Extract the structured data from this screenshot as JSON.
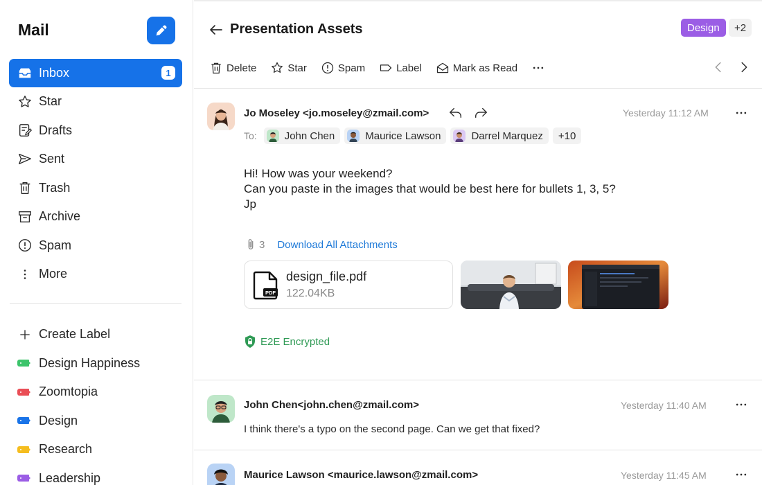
{
  "sidebar": {
    "title": "Mail",
    "nav": [
      {
        "label": "Inbox",
        "icon": "inbox-icon",
        "badge": "1",
        "active": true
      },
      {
        "label": "Star",
        "icon": "star-icon"
      },
      {
        "label": "Drafts",
        "icon": "drafts-icon"
      },
      {
        "label": "Sent",
        "icon": "sent-icon"
      },
      {
        "label": "Trash",
        "icon": "trash-icon"
      },
      {
        "label": "Archive",
        "icon": "archive-icon"
      },
      {
        "label": "Spam",
        "icon": "spam-icon"
      },
      {
        "label": "More",
        "icon": "more-vertical-icon"
      }
    ],
    "create_label": "Create Label",
    "labels": [
      {
        "label": "Design Happiness",
        "color": "#3cc46b"
      },
      {
        "label": "Zoomtopia",
        "color": "#ea4e56"
      },
      {
        "label": "Design",
        "color": "#1a74e8"
      },
      {
        "label": "Research",
        "color": "#f5bd1f"
      },
      {
        "label": "Leadership",
        "color": "#9b5de5"
      }
    ]
  },
  "header": {
    "subject": "Presentation Assets",
    "tag": "Design",
    "tag_color": "#9b5de5",
    "tag_more": "+2",
    "toolbar": {
      "delete": "Delete",
      "star": "Star",
      "spam": "Spam",
      "label": "Label",
      "mark_read": "Mark as Read"
    }
  },
  "messages": [
    {
      "from": "Jo Moseley <jo.moseley@zmail.com>",
      "time": "Yesterday 11:12 AM",
      "to_label": "To:",
      "recipients": [
        "John Chen",
        "Maurice Lawson",
        "Darrel Marquez"
      ],
      "recipients_more": "+10",
      "body": [
        "Hi! How was your weekend?",
        "Can you paste in the images that would be best here for bullets 1, 3, 5?",
        "Jp"
      ],
      "attachments_count": "3",
      "download_all": "Download All Attachments",
      "file": {
        "name": "design_file.pdf",
        "size": "122.04KB"
      },
      "encryption": "E2E Encrypted"
    },
    {
      "from": "John Chen<john.chen@zmail.com>",
      "time": "Yesterday 11:40 AM",
      "preview": "I think there's a typo on the second page. Can we get that fixed?"
    },
    {
      "from": "Maurice Lawson <maurice.lawson@zmail.com>",
      "time": "Yesterday 11:45 AM"
    }
  ],
  "colors": {
    "accent": "#1672e8",
    "encrypted": "#2f9a55",
    "link": "#1f7ad8"
  }
}
